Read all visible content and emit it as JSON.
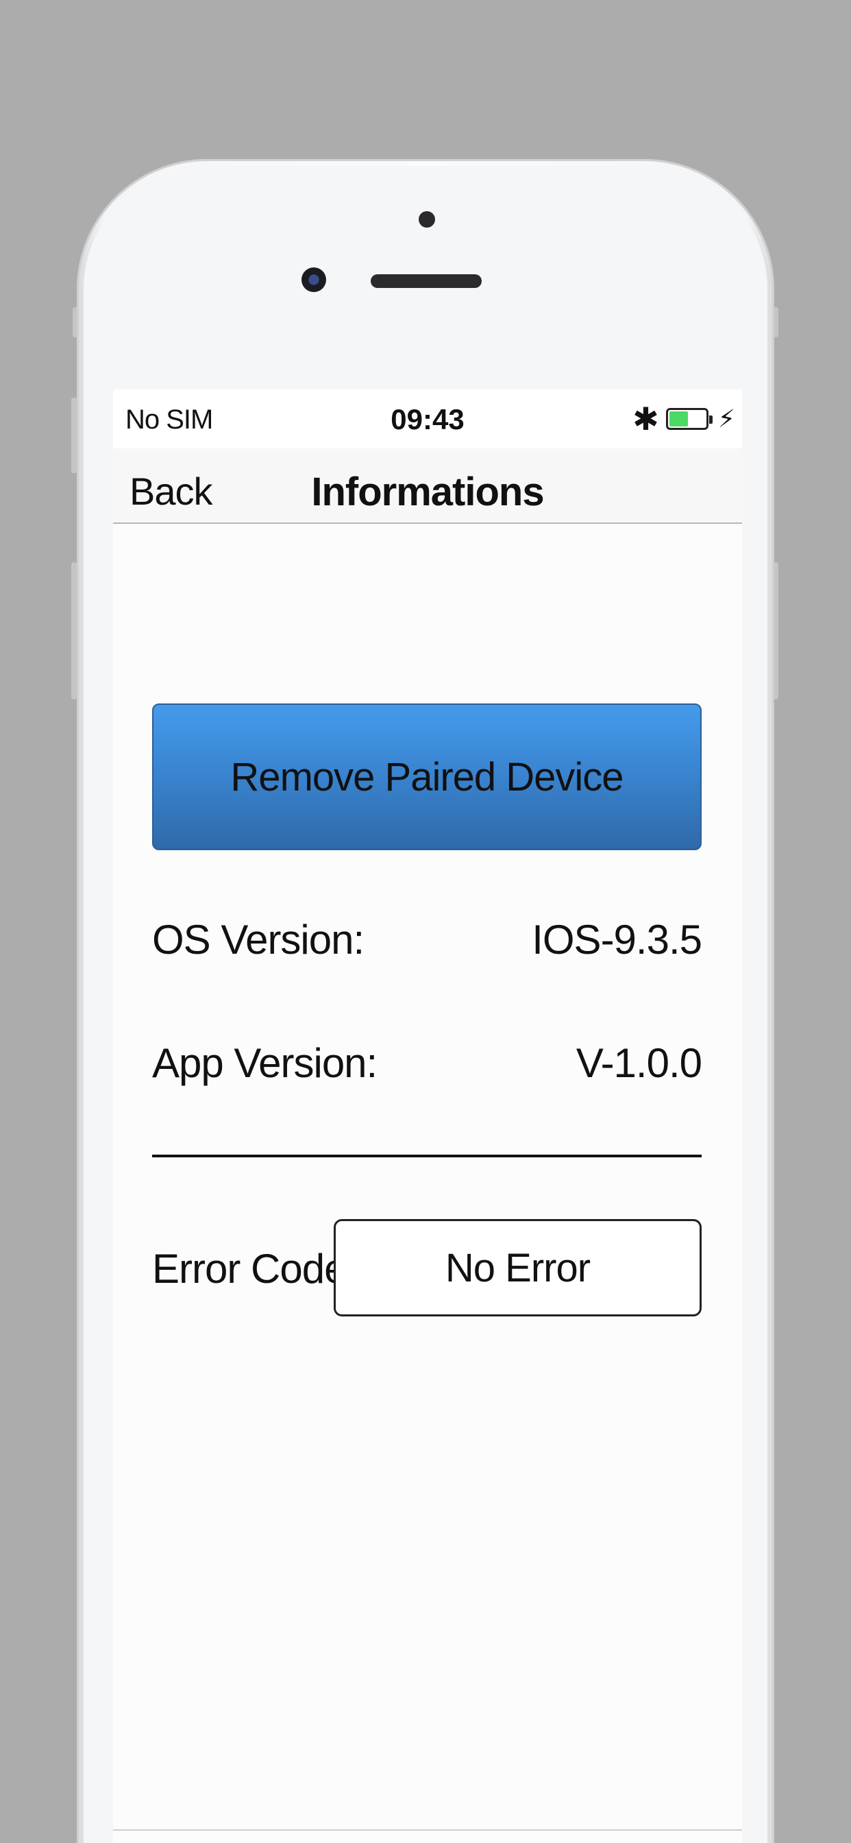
{
  "status_bar": {
    "carrier": "No SIM",
    "time": "09:43",
    "bluetooth_icon": "bluetooth-icon",
    "battery_icon": "battery-icon",
    "battery_level": 0.55,
    "battery_color": "#4cd964",
    "charging_icon": "lightning-icon"
  },
  "nav": {
    "back_label": "Back",
    "title": "Informations"
  },
  "actions": {
    "remove_paired_device_label": "Remove Paired Device",
    "button_color": "#3a85d2"
  },
  "info": {
    "os_version_label": "OS Version:",
    "os_version_value": "IOS-9.3.5",
    "app_version_label": "App Version:",
    "app_version_value": "V-1.0.0"
  },
  "error": {
    "label": "Error Code:",
    "value": "No Error"
  }
}
